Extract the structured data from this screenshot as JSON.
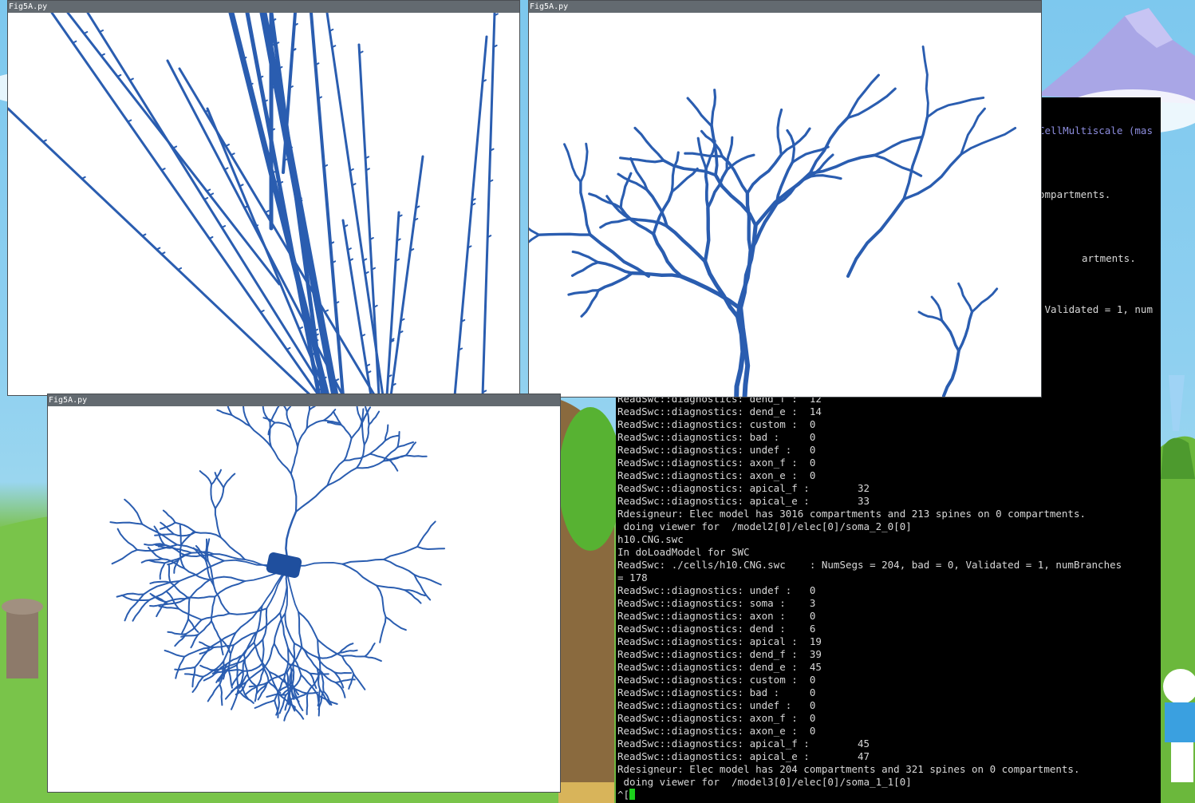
{
  "windows": [
    {
      "id": "top-left",
      "title": "Fig5A.py"
    },
    {
      "id": "top-right",
      "title": "Fig5A.py"
    },
    {
      "id": "bottom-left",
      "title": "Fig5A.py"
    }
  ],
  "colors": {
    "neuron": "#2a5db0",
    "titlebar": "#636a70",
    "terminal_bg": "#000000",
    "terminal_text": "#d8d8d8",
    "cursor": "#1bd01b"
  },
  "terminal": {
    "partial_top": [
      {
        "text": "CellMultiscale (mas",
        "highlight": true
      },
      {
        "text": "ompartments.",
        "highlight": false
      },
      {
        "text": "artments.",
        "highlight": false
      },
      {
        "text": " Validated = 1, num",
        "highlight": false
      }
    ],
    "lines": [
      "ReadSwc::diagnostics: dend_f :  12",
      "ReadSwc::diagnostics: dend_e :  14",
      "ReadSwc::diagnostics: custom :  0",
      "ReadSwc::diagnostics: bad :     0",
      "ReadSwc::diagnostics: undef :   0",
      "ReadSwc::diagnostics: axon_f :  0",
      "ReadSwc::diagnostics: axon_e :  0",
      "ReadSwc::diagnostics: apical_f :        32",
      "ReadSwc::diagnostics: apical_e :        33",
      "Rdesigneur: Elec model has 3016 compartments and 213 spines on 0 compartments.",
      " doing viewer for  /model2[0]/elec[0]/soma_2_0[0]",
      "h10.CNG.swc",
      "In doLoadModel for SWC",
      "ReadSwc: ./cells/h10.CNG.swc    : NumSegs = 204, bad = 0, Validated = 1, numBranches",
      "= 178",
      "ReadSwc::diagnostics: undef :   0",
      "ReadSwc::diagnostics: soma :    3",
      "ReadSwc::diagnostics: axon :    0",
      "ReadSwc::diagnostics: dend :    6",
      "ReadSwc::diagnostics: apical :  19",
      "ReadSwc::diagnostics: dend_f :  39",
      "ReadSwc::diagnostics: dend_e :  45",
      "ReadSwc::diagnostics: custom :  0",
      "ReadSwc::diagnostics: bad :     0",
      "ReadSwc::diagnostics: undef :   0",
      "ReadSwc::diagnostics: axon_f :  0",
      "ReadSwc::diagnostics: axon_e :  0",
      "ReadSwc::diagnostics: apical_f :        45",
      "ReadSwc::diagnostics: apical_e :        47",
      "Rdesigneur: Elec model has 204 compartments and 321 spines on 0 compartments.",
      " doing viewer for  /model3[0]/elec[0]/soma_1_1[0]"
    ],
    "prompt": "^["
  }
}
